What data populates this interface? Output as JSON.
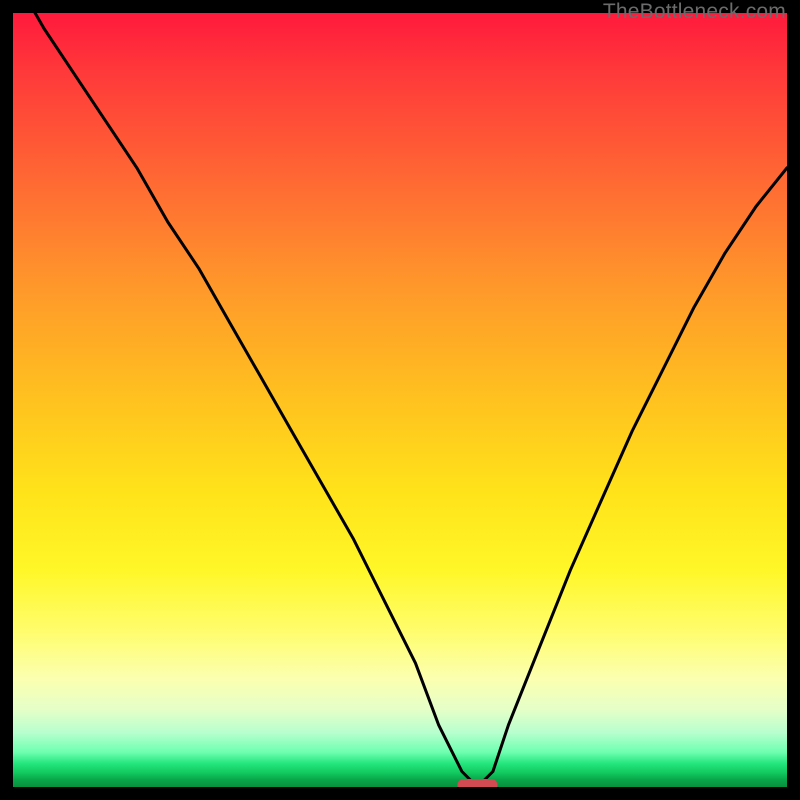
{
  "watermark": "TheBottleneck.com",
  "chart_data": {
    "type": "line",
    "title": "",
    "xlabel": "",
    "ylabel": "",
    "xlim": [
      0,
      100
    ],
    "ylim": [
      0,
      100
    ],
    "background_gradient": {
      "top": "#ff1a3c",
      "bottom": "#08903e",
      "meaning": "red = bad / bottleneck, green = good / balanced"
    },
    "series": [
      {
        "name": "bottleneck-curve",
        "x": [
          0,
          4,
          8,
          12,
          16,
          20,
          24,
          28,
          32,
          36,
          40,
          44,
          48,
          52,
          55,
          58,
          60,
          62,
          64,
          68,
          72,
          76,
          80,
          84,
          88,
          92,
          96,
          100
        ],
        "values": [
          105,
          98,
          92,
          86,
          80,
          73,
          67,
          60,
          53,
          46,
          39,
          32,
          24,
          16,
          8,
          2,
          0,
          2,
          8,
          18,
          28,
          37,
          46,
          54,
          62,
          69,
          75,
          80
        ]
      }
    ],
    "marker": {
      "name": "optimal-point",
      "x": 60,
      "y": 0.2,
      "color": "#d24a52",
      "shape": "pill"
    }
  }
}
